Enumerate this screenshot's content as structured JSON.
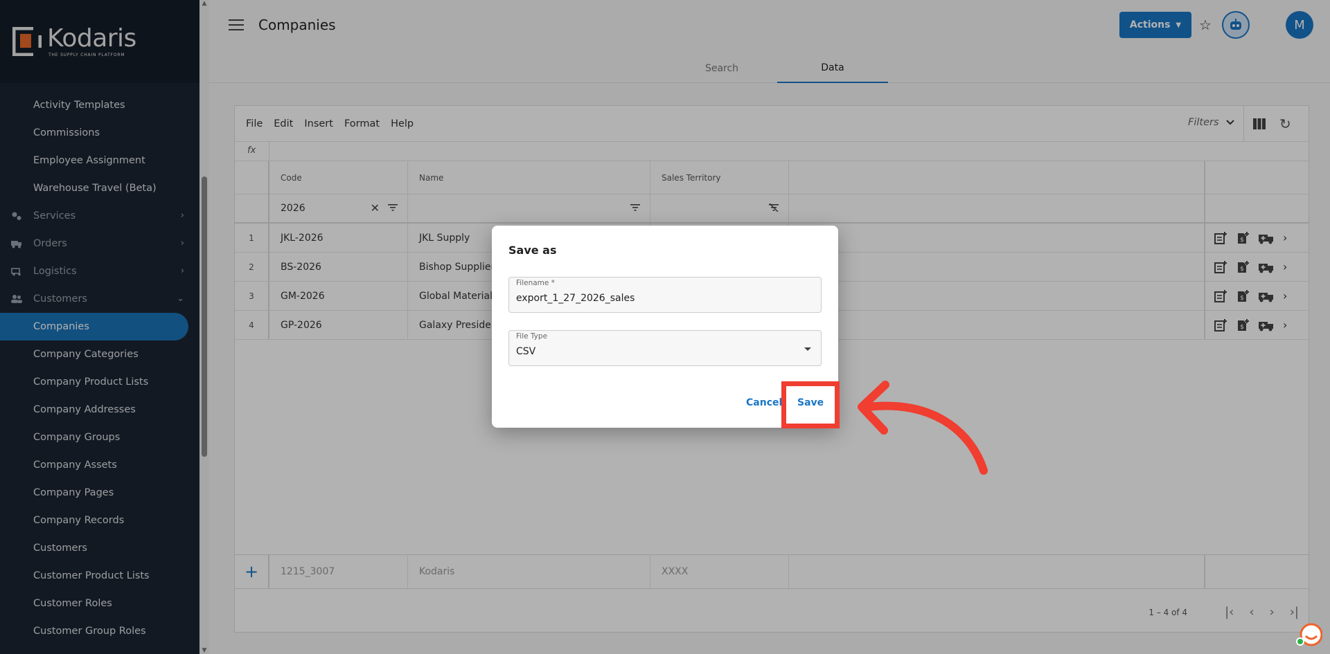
{
  "brand": {
    "name": "Kodaris",
    "tagline": "THE SUPPLY CHAIN PLATFORM"
  },
  "sidebar": {
    "items": [
      {
        "label": "Activity Templates",
        "type": "item"
      },
      {
        "label": "Commissions",
        "type": "item"
      },
      {
        "label": "Employee Assignment",
        "type": "item"
      },
      {
        "label": "Warehouse Travel (Beta)",
        "type": "item"
      },
      {
        "label": "Services",
        "type": "section",
        "icon": "gears-icon",
        "expanded": false
      },
      {
        "label": "Orders",
        "type": "section",
        "icon": "truck-icon",
        "expanded": false
      },
      {
        "label": "Logistics",
        "type": "section",
        "icon": "delivery-icon",
        "expanded": false
      },
      {
        "label": "Customers",
        "type": "section",
        "icon": "people-icon",
        "expanded": true
      },
      {
        "label": "Companies",
        "type": "item",
        "active": true
      },
      {
        "label": "Company Categories",
        "type": "item"
      },
      {
        "label": "Company Product Lists",
        "type": "item"
      },
      {
        "label": "Company Addresses",
        "type": "item"
      },
      {
        "label": "Company Groups",
        "type": "item"
      },
      {
        "label": "Company Assets",
        "type": "item"
      },
      {
        "label": "Company Pages",
        "type": "item"
      },
      {
        "label": "Company Records",
        "type": "item"
      },
      {
        "label": "Customers",
        "type": "item"
      },
      {
        "label": "Customer Product Lists",
        "type": "item"
      },
      {
        "label": "Customer Roles",
        "type": "item"
      },
      {
        "label": "Customer Group Roles",
        "type": "item"
      }
    ]
  },
  "header": {
    "title": "Companies",
    "actions_label": "Actions",
    "avatar_initial": "M",
    "tabs": [
      {
        "label": "Search",
        "active": false
      },
      {
        "label": "Data",
        "active": true
      }
    ]
  },
  "sheet": {
    "menu": [
      "File",
      "Edit",
      "Insert",
      "Format",
      "Help"
    ],
    "filters_label": "Filters",
    "fx_label": "fx",
    "columns": [
      "Code",
      "Name",
      "Sales Territory"
    ],
    "filter_values": {
      "code": "2026"
    },
    "rows": [
      {
        "num": "1",
        "code": "JKL-2026",
        "name": "JKL Supply"
      },
      {
        "num": "2",
        "code": "BS-2026",
        "name": "Bishop Suppliers"
      },
      {
        "num": "3",
        "code": "GM-2026",
        "name": "Global Materials"
      },
      {
        "num": "4",
        "code": "GP-2026",
        "name": "Galaxy President"
      }
    ],
    "new_row": {
      "code": "1215_3007",
      "name": "Kodaris",
      "territory": "XXXX"
    },
    "pagination": "1 – 4 of 4"
  },
  "dialog": {
    "title": "Save as",
    "filename_label": "Filename *",
    "filename_value": "export_1_27_2026_sales",
    "filetype_label": "File Type",
    "filetype_value": "CSV",
    "cancel_label": "Cancel",
    "save_label": "Save"
  },
  "colors": {
    "accent": "#1976c5",
    "sidebar_bg": "#1c2532",
    "highlight": "#f03e30"
  }
}
